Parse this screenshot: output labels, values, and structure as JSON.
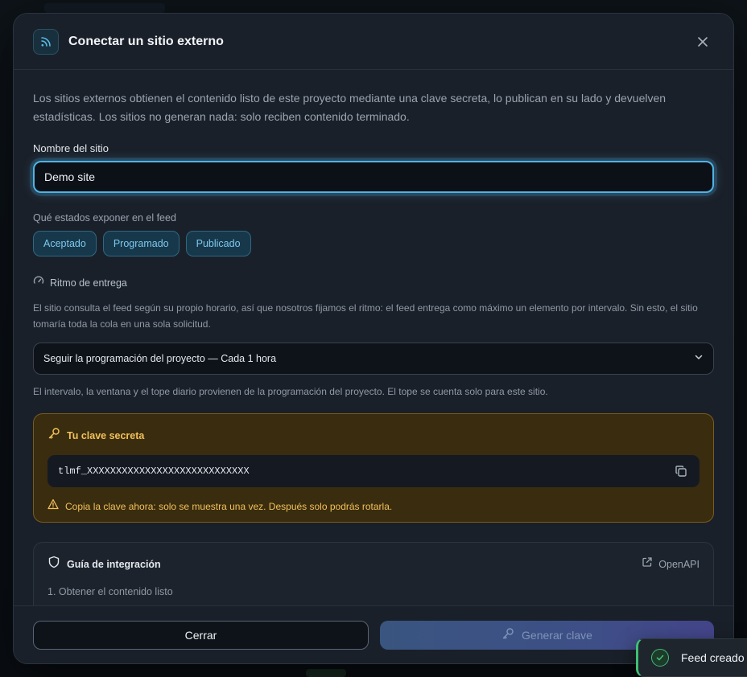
{
  "modal": {
    "title": "Conectar un sitio externo",
    "intro": "Los sitios externos obtienen el contenido listo de este proyecto mediante una clave secreta, lo publican en su lado y devuelven estadísticas. Los sitios no generan nada: solo reciben contenido terminado."
  },
  "site_name": {
    "label": "Nombre del sitio",
    "value": "Demo site"
  },
  "states": {
    "label": "Qué estados exponer en el feed",
    "chips": [
      "Aceptado",
      "Programado",
      "Publicado"
    ]
  },
  "pace": {
    "title": "Ritmo de entrega",
    "description": "El sitio consulta el feed según su propio horario, así que nosotros fijamos el ritmo: el feed entrega como máximo un elemento por intervalo. Sin esto, el sitio tomaría toda la cola en una sola solicitud.",
    "selected": "Seguir la programación del proyecto — Cada 1 hora",
    "note": "El intervalo, la ventana y el tope diario provienen de la programación del proyecto. El tope se cuenta solo para este sitio."
  },
  "secret": {
    "title": "Tu clave secreta",
    "key": "tlmf_XXXXXXXXXXXXXXXXXXXXXXXXXXXX",
    "warning": "Copia la clave ahora: solo se muestra una vez. Después solo podrás rotarla."
  },
  "guide": {
    "title": "Guía de integración",
    "openapi_label": "OpenAPI",
    "step1": "1. Obtener el contenido listo"
  },
  "footer": {
    "close_label": "Cerrar",
    "generate_label": "Generar clave"
  },
  "toast": {
    "text": "Feed creado"
  },
  "colors": {
    "accent": "#4fb3e6",
    "warning": "#f1c15a",
    "success": "#3fbf73"
  },
  "icons": {
    "header": "rss-icon",
    "close": "close-icon",
    "pace": "gauge-icon",
    "select": "chevron-down-icon",
    "secret": "key-icon",
    "copy": "copy-icon",
    "warning": "warning-icon",
    "guide": "shield-icon",
    "openapi": "external-link-icon",
    "generate": "key-icon",
    "toast": "check-circle-icon"
  }
}
